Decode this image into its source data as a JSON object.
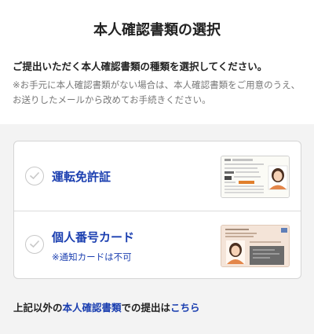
{
  "header": {
    "title": "本人確認書類の選択",
    "subtitle": "ご提出いただく本人確認書類の種類を選択してください。",
    "note": "※お手元に本人確認書類がない場合は、本人確認書類をご用意のうえ、お送りしたメールから改めてお手続きください。"
  },
  "options": [
    {
      "label": "運転免許証",
      "sublabel": "",
      "card_icon": "drivers-license-card"
    },
    {
      "label": "個人番号カード",
      "sublabel": "※通知カードは不可",
      "card_icon": "my-number-card"
    }
  ],
  "footer": {
    "prefix": "上記以外の",
    "link1": "本人確認書類",
    "middle": "での提出は",
    "link2": "こちら"
  },
  "colors": {
    "accent": "#1b3fb0",
    "background": "#f3f3f3",
    "license_stripe": "#e07f2d",
    "mynumber_card": "#f4e4d8"
  }
}
